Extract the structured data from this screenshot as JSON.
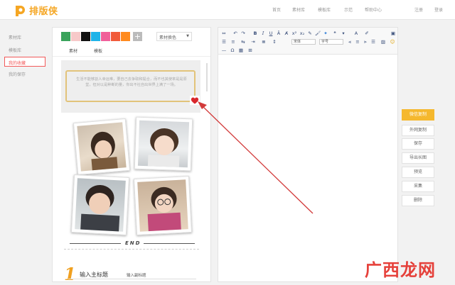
{
  "brand": {
    "name": "排版侠",
    "color": "#f5a623"
  },
  "nav": {
    "items": [
      "首页",
      "素材库",
      "模板库",
      "示范",
      "帮助中心"
    ],
    "register": "注册",
    "login": "登录"
  },
  "sidebar": {
    "items": [
      {
        "label": "素材库",
        "active": false
      },
      {
        "label": "模板库",
        "active": false
      },
      {
        "label": "我的收藏",
        "active": true
      },
      {
        "label": "我的保存",
        "active": false
      }
    ]
  },
  "materials": {
    "swatches": [
      "#3aa35b",
      "#f7c9c9",
      "#111111",
      "#1fb3e8",
      "#f0609a",
      "#f15a3a",
      "#ff8a1e"
    ],
    "color_select": "素材换色",
    "tabs": [
      "素材",
      "模板"
    ],
    "quote": "生活不能够割人幸运难，要自己去争取和提合，而不也其使率是是原堂，但对以是种断的量，你出不社自出世界上满了一场。",
    "end_label": "END",
    "heading_number": "1",
    "heading_main": "输入主标题",
    "heading_sub": "输入副标题"
  },
  "actions": [
    "微信复制",
    "外网复制",
    "保存",
    "导出长图",
    "预览",
    "采集",
    "删除"
  ],
  "editor": {
    "font_select": "宋体",
    "size_select": "字号"
  },
  "watermark": "广西龙网"
}
